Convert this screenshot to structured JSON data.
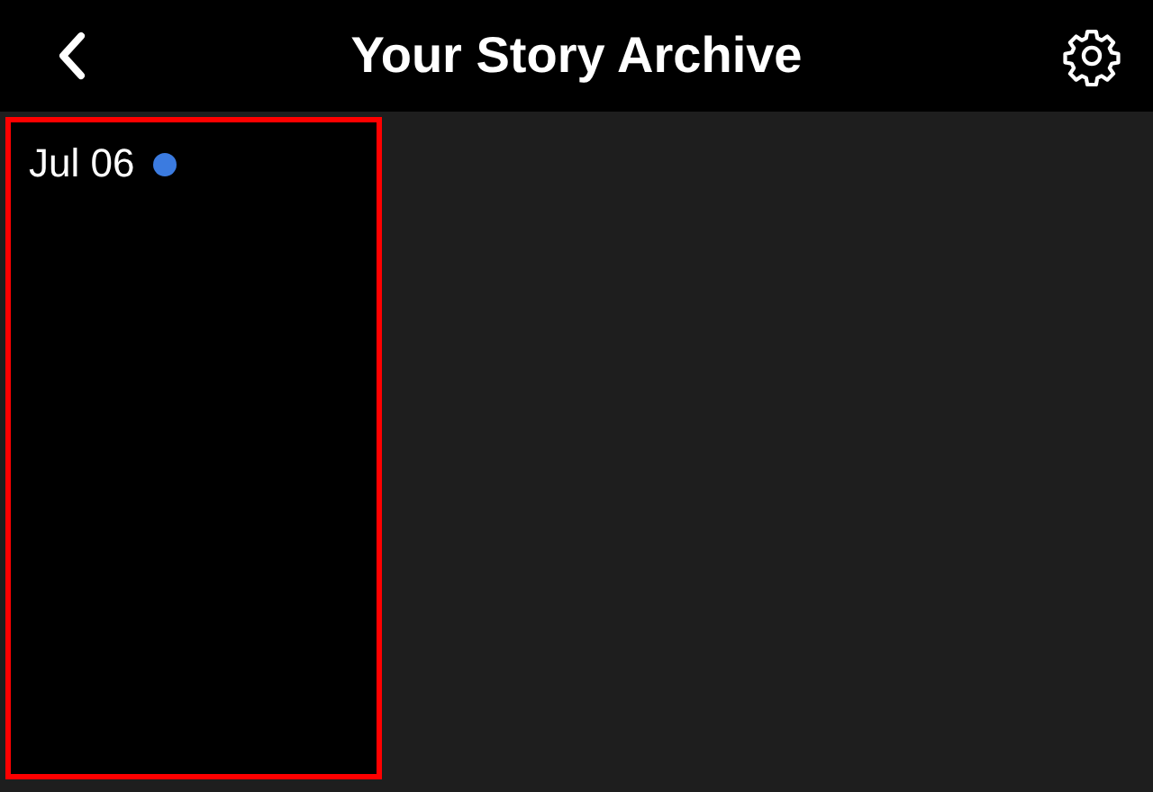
{
  "header": {
    "title": "Your Story Archive"
  },
  "stories": [
    {
      "date": "Jul 06",
      "new": true,
      "selected": true
    }
  ]
}
